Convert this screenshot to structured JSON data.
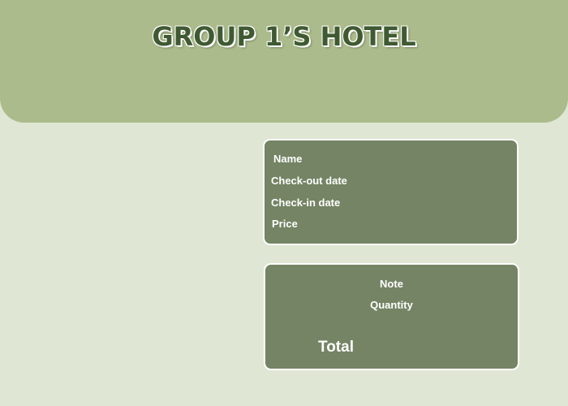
{
  "header": {
    "title": "GROUP 1’S HOTEL"
  },
  "booking": {
    "name_label": "Name",
    "checkout_label": "Check-out date",
    "checkin_label": "Check-in date",
    "price_label": "Price"
  },
  "summary": {
    "note_label": "Note",
    "quantity_label": "Quantity",
    "total_label": "Total"
  },
  "colors": {
    "page_background": "#dfe6d3",
    "header_background": "#abbb8b",
    "title_color": "#3f5a32",
    "card_background": "#748464",
    "card_border": "#ffffff"
  }
}
